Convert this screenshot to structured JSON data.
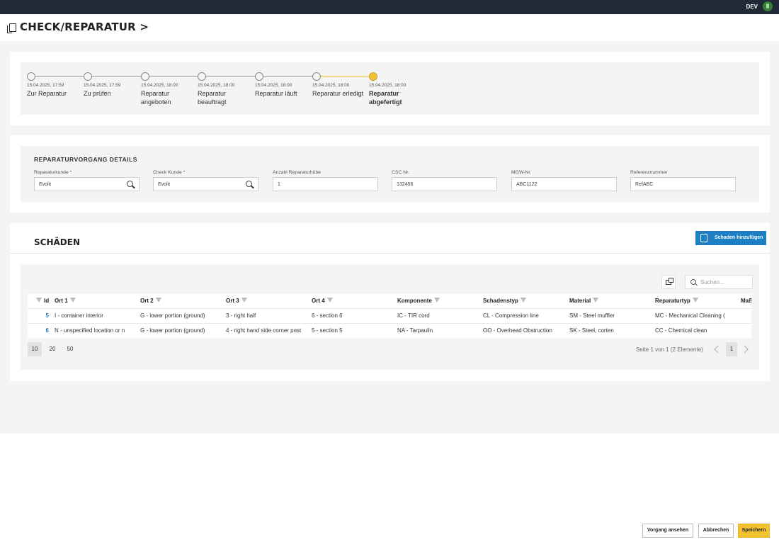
{
  "topbar": {
    "env": "DEV"
  },
  "header": {
    "title": "CHECK/REPARATUR >"
  },
  "stepper": [
    {
      "date": "15.04.2025, 17:59",
      "label": "Zur Reparatur",
      "active": false
    },
    {
      "date": "15.04.2025, 17:59",
      "label": "Zu prüfen",
      "active": false
    },
    {
      "date": "15.04.2025, 18:00",
      "label": "Reparatur angeboten",
      "active": false
    },
    {
      "date": "15.04.2025, 18:00",
      "label": "Reparatur beauftragt",
      "active": false
    },
    {
      "date": "15.04.2025, 18:00",
      "label": "Reparatur läuft",
      "active": false
    },
    {
      "date": "15.04.2025, 18:00",
      "label": "Reparatur erledigt",
      "active": false
    },
    {
      "date": "15.04.2025, 18:00",
      "label": "Reparatur abgefertigt",
      "active": true
    }
  ],
  "details": {
    "title": "REPARATURVORGANG DETAILS",
    "fields": [
      {
        "label": "Reparaturkunde *",
        "value": "Evolit",
        "search": true
      },
      {
        "label": "Check Kunde *",
        "value": "Evolit",
        "search": true
      },
      {
        "label": "Anzahl Reparaturhübe",
        "value": "1",
        "search": false
      },
      {
        "label": "CSC Nr.",
        "value": "132456",
        "search": false
      },
      {
        "label": "MGW-Nr.",
        "value": "ABC1122",
        "search": false
      },
      {
        "label": "Referenznummer",
        "value": "RefABC",
        "search": false
      }
    ]
  },
  "schaeden": {
    "title": "SCHÄDEN",
    "add_button": "Schaden hinzufügen",
    "search_placeholder": "Suchen...",
    "columns": [
      "Id",
      "Ort 1",
      "Ort 2",
      "Ort 3",
      "Ort 4",
      "Komponente",
      "Schadenstyp",
      "Material",
      "Reparaturtyp",
      "Maß"
    ],
    "rows": [
      [
        "5",
        "I - container interior",
        "G - lower portion (ground)",
        "3 - right half",
        "6 - section 6",
        "IC - TIR cord",
        "CL - Compression line",
        "SM - Steel muffler",
        "MC - Mechanical Cleaning (",
        ""
      ],
      [
        "6",
        "N - unspecified location or n",
        "G - lower portion (ground)",
        "4 - right hand side corner post",
        "5 - section 5",
        "NA - Tarpaulin",
        "OO - Overhead Obstruction",
        "SK - Steel, corten",
        "CC - Chemical clean",
        ""
      ]
    ],
    "page_sizes": [
      "10",
      "20",
      "50"
    ],
    "selected_page_size": "10",
    "page_info": "Seite 1 von 1 (2 Elemente)",
    "current_page": "1"
  },
  "footer": {
    "preview": "Vorgang ansehen",
    "cancel": "Abbrechen",
    "save": "Speichern"
  },
  "colors": {
    "accent": "#f2c230",
    "primary": "#1c7fc4",
    "topbar": "#1f2a36"
  }
}
